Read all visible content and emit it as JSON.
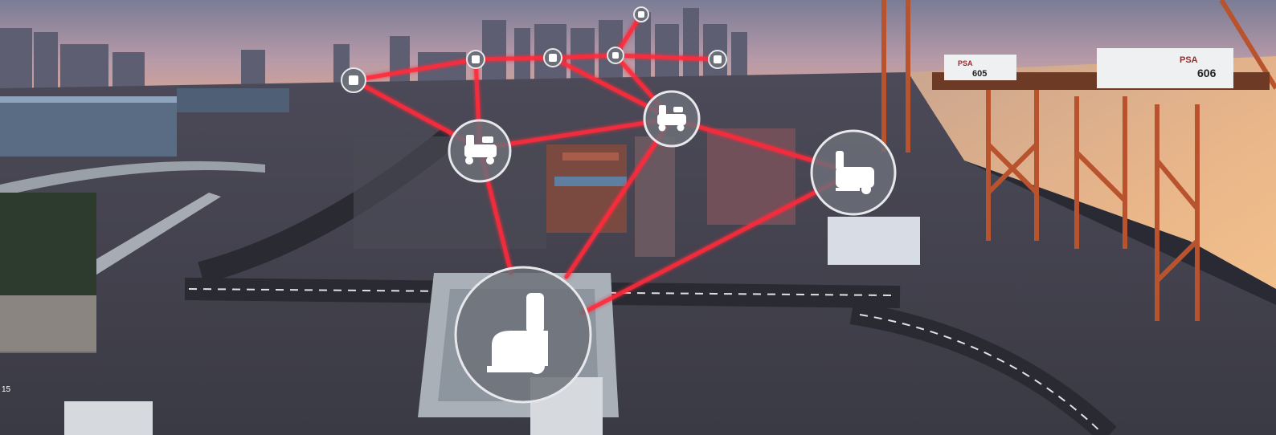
{
  "scene": {
    "accent_link_color": "#ff2a3a",
    "node_fill": "#6b6f78",
    "node_stroke": "#e8e8ec"
  },
  "cranes": [
    {
      "brand": "PSA",
      "number": "605"
    },
    {
      "brand": "PSA",
      "number": "606"
    }
  ],
  "nodes": [
    {
      "id": "hub-left",
      "icon": "ride-on-scrubber-icon"
    },
    {
      "id": "hub-center",
      "icon": "ride-on-scrubber-icon"
    },
    {
      "id": "hub-right",
      "icon": "walk-behind-scrubber-icon"
    },
    {
      "id": "hub-main",
      "icon": "walk-behind-scrubber-icon"
    },
    {
      "id": "small-1",
      "icon": "device-icon"
    },
    {
      "id": "small-2",
      "icon": "device-icon"
    },
    {
      "id": "small-3",
      "icon": "device-icon"
    },
    {
      "id": "small-4",
      "icon": "device-icon"
    },
    {
      "id": "small-5",
      "icon": "device-icon"
    },
    {
      "id": "small-6",
      "icon": "device-icon"
    }
  ],
  "corner_text": "15"
}
